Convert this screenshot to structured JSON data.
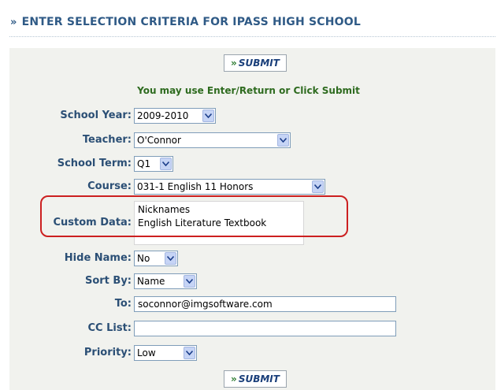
{
  "header": {
    "title": "ENTER SELECTION CRITERIA FOR IPASS HIGH SCHOOL",
    "chevron": "»"
  },
  "submit": {
    "label": "SUBMIT",
    "icon": "»"
  },
  "hint": "You may use Enter/Return or Click Submit",
  "fields": {
    "school_year": {
      "label": "School Year:",
      "value": "2009-2010"
    },
    "teacher": {
      "label": "Teacher:",
      "value": "O'Connor"
    },
    "school_term": {
      "label": "School Term:",
      "value": "Q1"
    },
    "course": {
      "label": "Course:",
      "value": "031-1 English 11 Honors"
    },
    "custom_data": {
      "label": "Custom Data:",
      "options": [
        "Nicknames",
        "English Literature Textbook"
      ]
    },
    "hide_name": {
      "label": "Hide Name:",
      "value": "No"
    },
    "sort_by": {
      "label": "Sort By:",
      "value": "Name"
    },
    "to": {
      "label": "To:",
      "value": "soconnor@imgsoftware.com"
    },
    "cc_list": {
      "label": "CC List:",
      "value": ""
    },
    "priority": {
      "label": "Priority:",
      "value": "Low"
    }
  },
  "colors": {
    "highlight": "#cc2020",
    "panel": "#f1f2ee",
    "hint": "#2e6b1f"
  }
}
